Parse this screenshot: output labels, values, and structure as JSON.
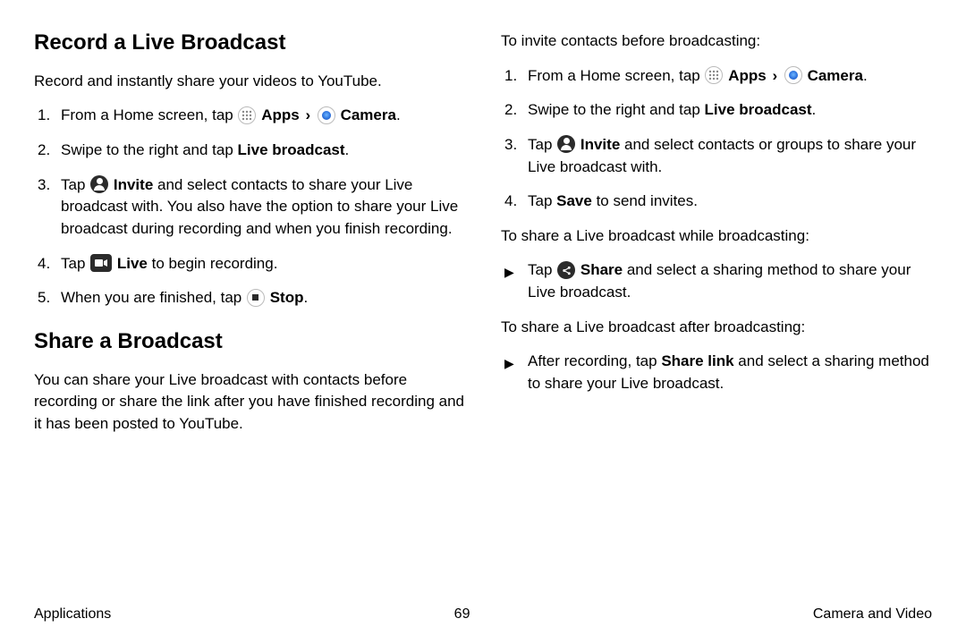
{
  "col1": {
    "heading1": "Record a Live Broadcast",
    "intro1": "Record and instantly share your videos to YouTube.",
    "steps1": {
      "s1a": "From a Home screen, tap ",
      "apps": "Apps",
      "camera": "Camera",
      "s1b": ".",
      "s2a": "Swipe to the right and tap ",
      "s2b": "Live broadcast",
      "s2c": ".",
      "s3a": "Tap ",
      "s3b": "Invite",
      "s3c": " and select contacts to share your Live broadcast with. You also have the option to share your Live broadcast during recording and when you finish recording.",
      "s4a": "Tap ",
      "s4b": "Live",
      "s4c": " to begin recording.",
      "s5a": "When you are finished, tap ",
      "s5b": "Stop",
      "s5c": "."
    },
    "heading2": "Share a Broadcast",
    "intro2": "You can share your Live broadcast with contacts before recording or share the link after you have finished recording and it has been posted to YouTube."
  },
  "col2": {
    "p1": "To invite contacts before broadcasting:",
    "steps2": {
      "s1a": "From a Home screen, tap ",
      "apps": "Apps",
      "camera": "Camera",
      "s1b": ".",
      "s2a": "Swipe to the right and tap ",
      "s2b": "Live broadcast",
      "s2c": ".",
      "s3a": "Tap ",
      "s3b": "Invite",
      "s3c": " and select contacts or groups to share your Live broadcast with.",
      "s4a": "Tap ",
      "s4b": "Save",
      "s4c": " to send invites."
    },
    "p2": "To share a Live broadcast while broadcasting:",
    "shareWhile": {
      "a": "Tap ",
      "b": "Share",
      "c": " and select a sharing method to share your Live broadcast."
    },
    "p3": "To share a Live broadcast after broadcasting:",
    "shareAfter": {
      "a": "After recording, tap ",
      "b": "Share link",
      "c": " and select a sharing method to share your Live broadcast."
    }
  },
  "footer": {
    "left": "Applications",
    "page": "69",
    "right": "Camera and Video"
  },
  "glyphs": {
    "chevron": "›",
    "triangle": "▶"
  }
}
